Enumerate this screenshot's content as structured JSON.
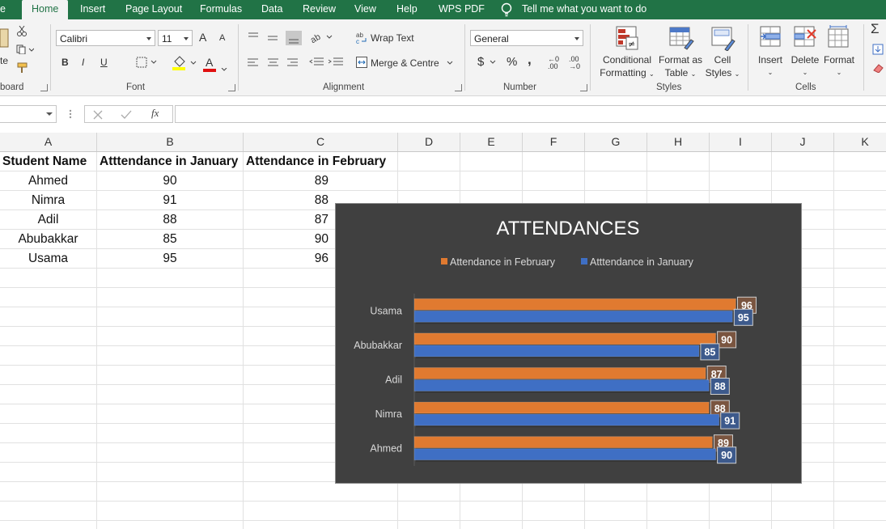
{
  "tabs": [
    {
      "key": "file",
      "label": "e"
    },
    {
      "key": "home",
      "label": "Home"
    },
    {
      "key": "insert",
      "label": "Insert"
    },
    {
      "key": "page_layout",
      "label": "Page Layout"
    },
    {
      "key": "formulas",
      "label": "Formulas"
    },
    {
      "key": "data",
      "label": "Data"
    },
    {
      "key": "review",
      "label": "Review"
    },
    {
      "key": "view",
      "label": "View"
    },
    {
      "key": "help",
      "label": "Help"
    },
    {
      "key": "wps",
      "label": "WPS PDF"
    }
  ],
  "tell_me": "Tell me what you want to do",
  "ribbon": {
    "clipboard": {
      "label": "board",
      "paste_partial": "te"
    },
    "font": {
      "label": "Font",
      "name": "Calibri",
      "size": "11",
      "bold": "B",
      "italic": "I",
      "underline": "U",
      "grow": "A",
      "shrink": "A",
      "font_color_letter": "A"
    },
    "alignment": {
      "label": "Alignment",
      "wrap_text": "Wrap Text",
      "merge": "Merge & Centre"
    },
    "number": {
      "label": "Number",
      "format": "General",
      "currency": "$",
      "percent": "%",
      "comma": ",",
      "inc_dec": "←0 .00",
      "dec_dec": ".00 →0"
    },
    "styles": {
      "label": "Styles",
      "conditional": [
        "Conditional",
        "Formatting"
      ],
      "format_table": [
        "Format as",
        "Table"
      ],
      "cell_styles": [
        "Cell",
        "Styles"
      ]
    },
    "cells": {
      "label": "Cells",
      "insert": "Insert",
      "delete": "Delete",
      "format": "Format"
    },
    "editing": {
      "sigma": "Σ"
    }
  },
  "formula_bar": {
    "fx": "fx",
    "value": ""
  },
  "columns": [
    "A",
    "B",
    "C",
    "D",
    "E",
    "F",
    "G",
    "H",
    "I",
    "J",
    "K"
  ],
  "sheet": {
    "headers": [
      "Student Name",
      "Atttendance in January",
      "Attendance in February"
    ],
    "rows": [
      [
        "Ahmed",
        "90",
        "89"
      ],
      [
        "Nimra",
        "91",
        "88"
      ],
      [
        "Adil",
        "88",
        "87"
      ],
      [
        "Abubakkar",
        "85",
        "90"
      ],
      [
        "Usama",
        "95",
        "96"
      ]
    ]
  },
  "colors": {
    "ribbon_green": "#217346",
    "series_feb": "#e07a30",
    "series_jan": "#3f6fc4",
    "chart_bg": "#404040"
  },
  "chart_data": {
    "type": "bar",
    "orientation": "horizontal",
    "title": "ATTENDANCES",
    "categories": [
      "Ahmed",
      "Nimra",
      "Adil",
      "Abubakkar",
      "Usama"
    ],
    "series": [
      {
        "name": "Attendance in February",
        "values": [
          89,
          88,
          87,
          90,
          96
        ],
        "color": "#e07a30"
      },
      {
        "name": "Atttendance in January",
        "values": [
          90,
          91,
          88,
          85,
          95
        ],
        "color": "#3f6fc4"
      }
    ],
    "legend": "top",
    "data_labels": true,
    "xlim": [
      0,
      100
    ],
    "grid": false
  }
}
